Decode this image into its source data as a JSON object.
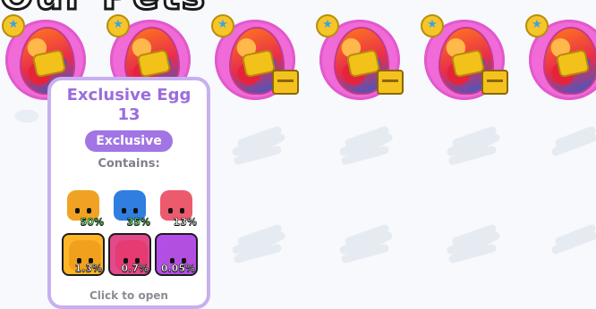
{
  "page": {
    "title_fragment": "Our Pets"
  },
  "eggs": [
    {
      "name": "exclusive-egg-1",
      "star_badge": "★",
      "box_badge": false
    },
    {
      "name": "exclusive-egg-2",
      "star_badge": "★",
      "box_badge": false
    },
    {
      "name": "exclusive-egg-3",
      "star_badge": "★",
      "box_badge": true
    },
    {
      "name": "exclusive-egg-4",
      "star_badge": "★",
      "box_badge": true
    },
    {
      "name": "exclusive-egg-5",
      "star_badge": "★",
      "box_badge": true
    },
    {
      "name": "exclusive-egg-6",
      "star_badge": "★",
      "box_badge": false
    }
  ],
  "tooltip": {
    "title": "Exclusive Egg",
    "count": "13",
    "tag": "Exclusive",
    "contains_label": "Contains:",
    "footer": "Click to open",
    "pets": [
      {
        "chance": "50%",
        "color": "#f0a322",
        "tile": false,
        "chance_color": "green"
      },
      {
        "chance": "35%",
        "color": "#2f7ee0",
        "tile": false,
        "chance_color": "green"
      },
      {
        "chance": "13%",
        "color": "#ec5a6e",
        "tile": false,
        "chance_color": "white"
      },
      {
        "chance": "1.3%",
        "color": "#f1a01e",
        "tile": true,
        "tile_bg": "#ffb526",
        "chance_color": "white"
      },
      {
        "chance": "0.7%",
        "color": "#e63a73",
        "tile": true,
        "tile_bg": "#e14a8b",
        "chance_color": "white"
      },
      {
        "chance": "0.05%",
        "color": "#b34fe0",
        "tile": true,
        "tile_bg": "#b44ee8",
        "chance_color": "white"
      }
    ]
  },
  "colors": {
    "accent_purple": "#9b6ddc",
    "tag_bg": "#a275e4",
    "ring_pink": "#f06ad8"
  }
}
